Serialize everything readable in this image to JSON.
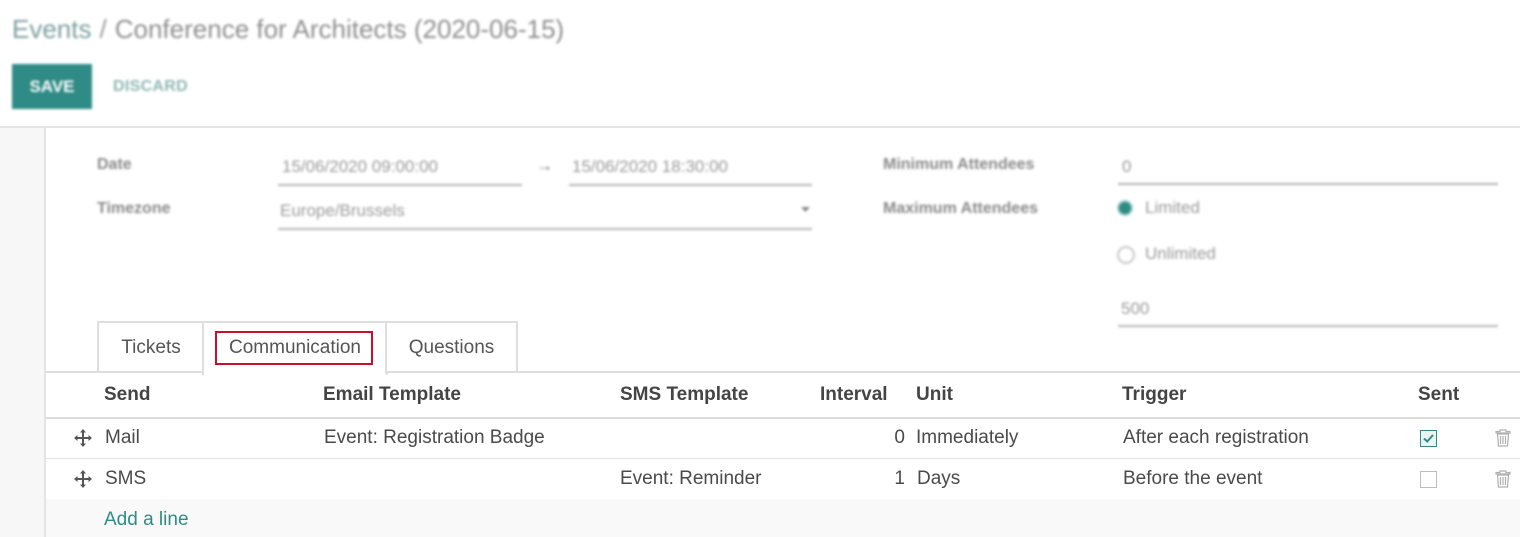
{
  "breadcrumb": {
    "parent": "Events",
    "separator": "/",
    "current": "Conference for Architects (2020-06-15)"
  },
  "actions": {
    "save_label": "SAVE",
    "discard_label": "DISCARD"
  },
  "form": {
    "date_label": "Date",
    "date_start": "15/06/2020 09:00:00",
    "date_arrow": "→",
    "date_end": "15/06/2020 18:30:00",
    "timezone_label": "Timezone",
    "timezone_value": "Europe/Brussels",
    "min_attendees_label": "Minimum Attendees",
    "min_attendees_value": "0",
    "max_attendees_label": "Maximum Attendees",
    "max_option_limited": "Limited",
    "max_option_unlimited": "Unlimited",
    "max_attendees_value": "500"
  },
  "tabs": [
    {
      "label": "Tickets"
    },
    {
      "label": "Communication",
      "active": true
    },
    {
      "label": "Questions"
    }
  ],
  "table": {
    "headers": [
      "Send",
      "Email Template",
      "SMS Template",
      "Interval",
      "Unit",
      "Trigger",
      "Sent"
    ],
    "rows": [
      {
        "send": "Mail",
        "email_template": "Event: Registration Badge",
        "sms_template": "",
        "interval": "0",
        "unit": "Immediately",
        "trigger": "After each registration",
        "sent": true
      },
      {
        "send": "SMS",
        "email_template": "",
        "sms_template": "Event: Reminder",
        "interval": "1",
        "unit": "Days",
        "trigger": "Before the event",
        "sent": false
      }
    ],
    "add_line_label": "Add a line"
  },
  "colors": {
    "accent": "#2f8b85",
    "highlight_border": "#c8102e"
  },
  "icons": [
    "drag-handle-icon",
    "trash-icon",
    "checkbox-icon",
    "dropdown-caret-icon"
  ]
}
